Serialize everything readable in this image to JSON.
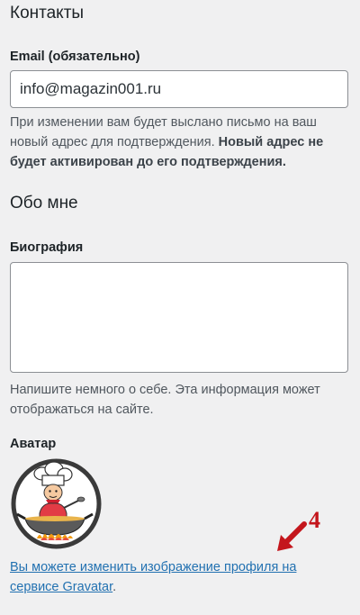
{
  "sections": {
    "contacts_title": "Контакты",
    "about_title": "Обо мне"
  },
  "email": {
    "label": "Email (обязательно)",
    "value": "info@magazin001.ru",
    "desc_prefix": "При изменении вам будет выслано письмо на ваш новый адрес для подтверждения. ",
    "desc_bold": "Новый адрес не будет активирован до его подтверждения."
  },
  "bio": {
    "label": "Биография",
    "value": "",
    "desc": "Напишите немного о себе. Эта информация может отображаться на сайте."
  },
  "avatar": {
    "label": "Аватар",
    "icon": "chef-cooking-avatar",
    "link_text": "Вы можете изменить изображение профиля на сервисе Gravatar",
    "link_suffix": "."
  },
  "annotation": {
    "number": "4",
    "color": "#c4161c"
  },
  "colors": {
    "link": "#2271b1",
    "background": "#f0f0f1"
  }
}
